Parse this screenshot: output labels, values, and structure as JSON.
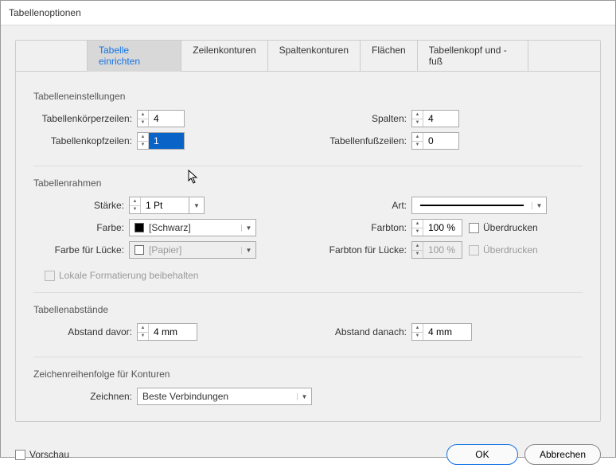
{
  "title": "Tabellenoptionen",
  "tabs": [
    "Tabelle einrichten",
    "Zeilenkonturen",
    "Spaltenkonturen",
    "Flächen",
    "Tabellenkopf und -fuß"
  ],
  "activeTab": 0,
  "settings": {
    "heading": "Tabelleneinstellungen",
    "bodyRowsLabel": "Tabellenkörperzeilen:",
    "bodyRows": "4",
    "headerRowsLabel": "Tabellenkopfzeilen:",
    "headerRows": "1",
    "columnsLabel": "Spalten:",
    "columns": "4",
    "footerRowsLabel": "Tabellenfußzeilen:",
    "footerRows": "0"
  },
  "frame": {
    "heading": "Tabellenrahmen",
    "weightLabel": "Stärke:",
    "weight": "1 Pt",
    "colorLabel": "Farbe:",
    "colorName": "[Schwarz]",
    "gapColorLabel": "Farbe für Lücke:",
    "gapColorName": "[Papier]",
    "typeLabel": "Art:",
    "tintLabel": "Farbton:",
    "tint": "100 %",
    "gapTintLabel": "Farbton für Lücke:",
    "gapTint": "100 %",
    "overprint": "Überdrucken",
    "preserveLocal": "Lokale Formatierung beibehalten"
  },
  "spacing": {
    "heading": "Tabellenabstände",
    "beforeLabel": "Abstand davor:",
    "before": "4 mm",
    "afterLabel": "Abstand danach:",
    "after": "4 mm"
  },
  "drawOrder": {
    "heading": "Zeichenreihenfolge für Konturen",
    "drawLabel": "Zeichnen:",
    "drawValue": "Beste Verbindungen"
  },
  "footer": {
    "preview": "Vorschau",
    "ok": "OK",
    "cancel": "Abbrechen"
  }
}
